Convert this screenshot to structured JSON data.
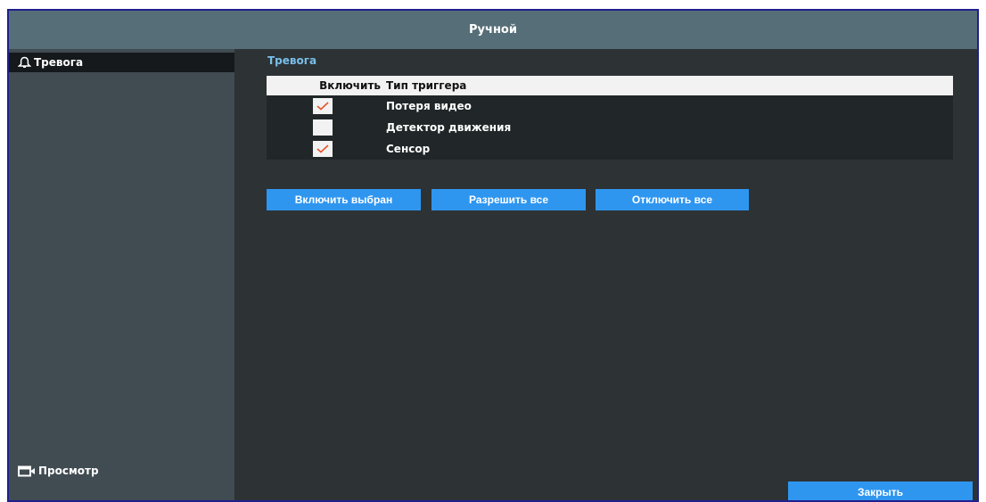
{
  "window": {
    "title": "Ручной"
  },
  "sidebar": {
    "items": [
      {
        "label": "Тревога",
        "icon": "bell-icon"
      },
      {
        "label": "Просмотр",
        "icon": "camera-icon"
      }
    ]
  },
  "main": {
    "section_title": "Тревога",
    "table": {
      "headers": [
        "Включить",
        "Тип триггера"
      ],
      "rows": [
        {
          "enabled": true,
          "label": "Потеря видео"
        },
        {
          "enabled": false,
          "label": "Детектор движения"
        },
        {
          "enabled": true,
          "label": "Сенсор"
        }
      ]
    },
    "buttons": {
      "enable_selected": "Включить выбран",
      "allow_all": "Разрешить все",
      "disable_all": "Отключить все"
    },
    "close_label": "Закрыть"
  },
  "colors": {
    "titlebar": "#566e77",
    "sidebar": "#414b52",
    "accent": "#2f96f0",
    "section_title": "#79bfe9",
    "check": "#e8542c"
  }
}
